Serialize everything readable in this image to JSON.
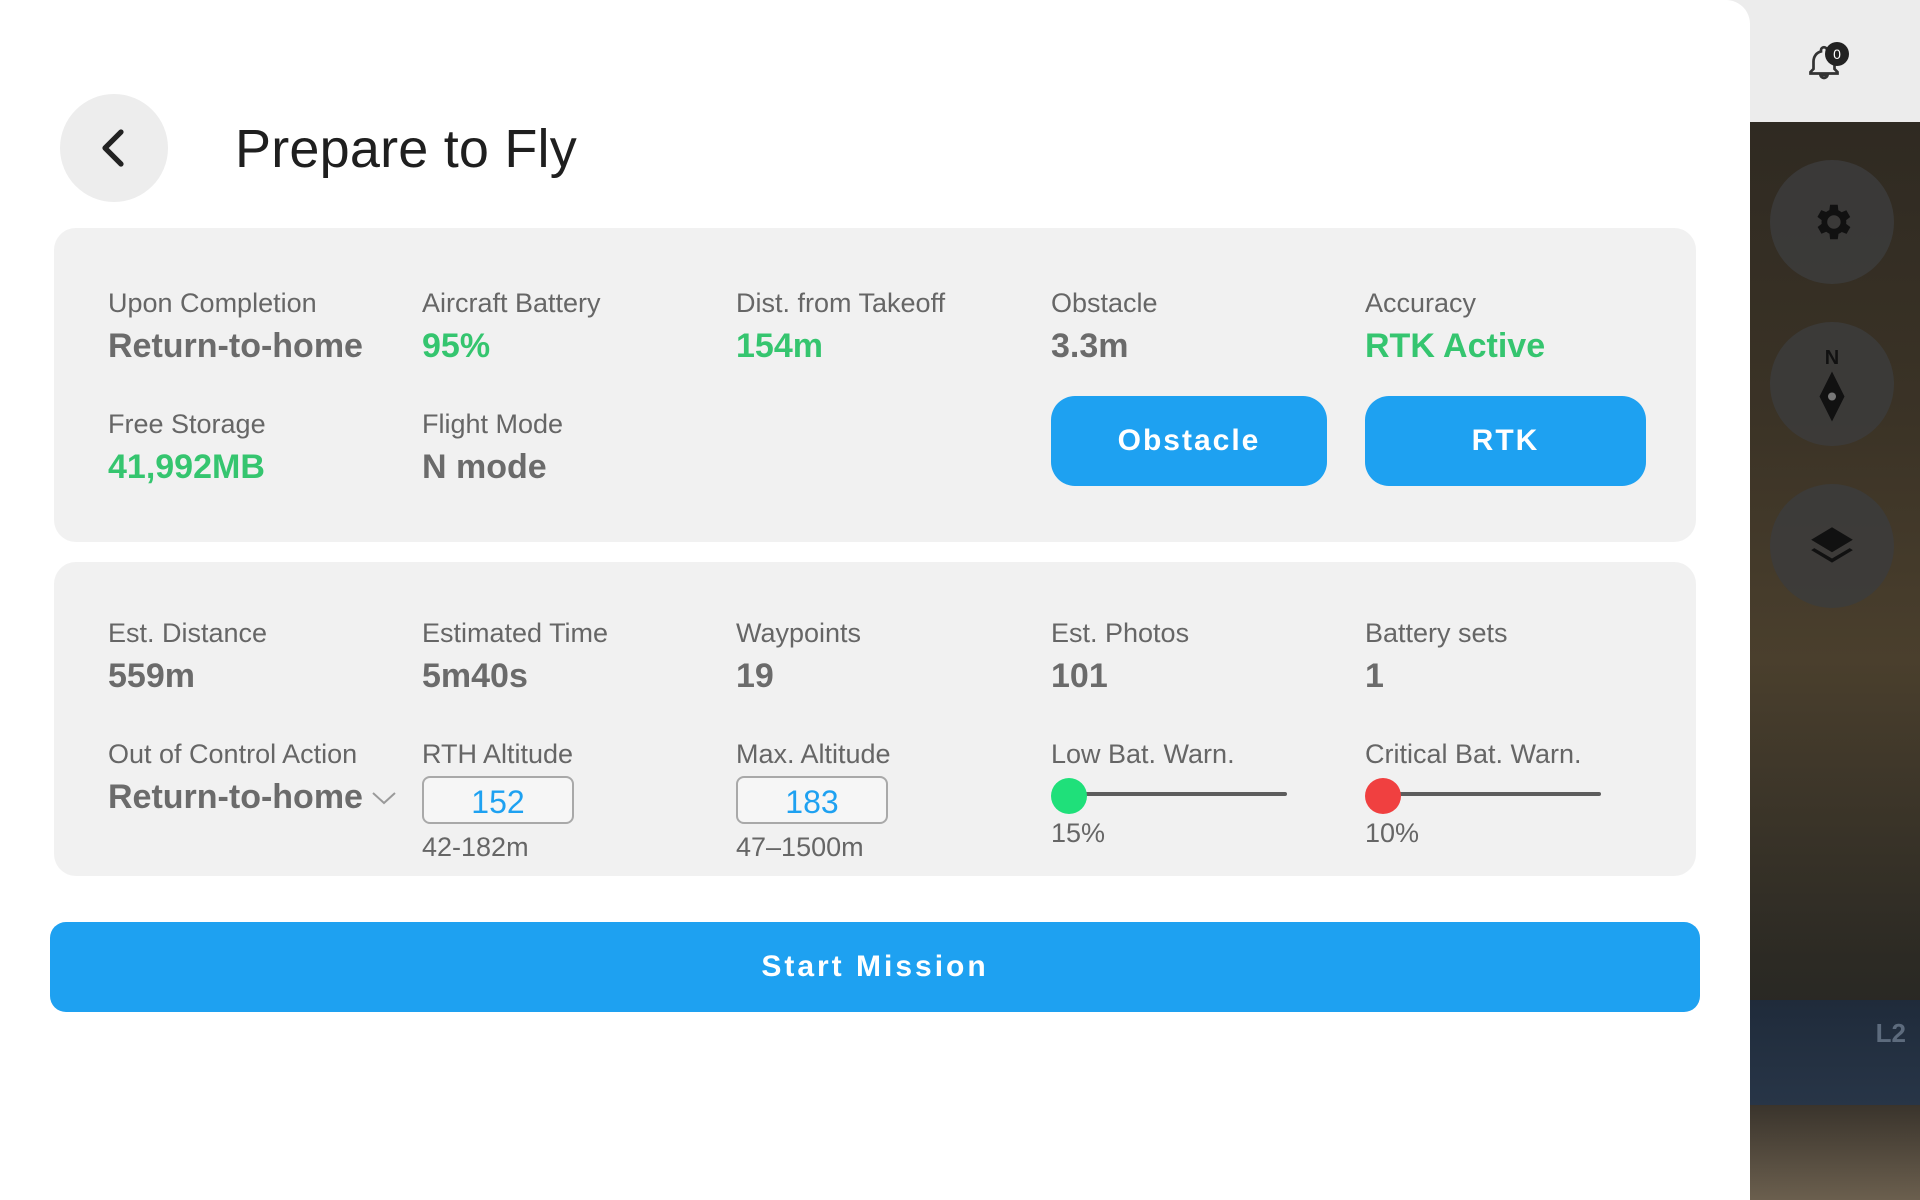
{
  "header": {
    "title": "Prepare to Fly"
  },
  "notifications": {
    "count": "0"
  },
  "map": {
    "layer_label": "L2"
  },
  "status_panel": {
    "upon_completion": {
      "label": "Upon Completion",
      "value": "Return-to-home"
    },
    "aircraft_battery": {
      "label": "Aircraft Battery",
      "value": "95%"
    },
    "dist_from_takeoff": {
      "label": "Dist. from Takeoff",
      "value": "154m"
    },
    "obstacle": {
      "label": "Obstacle",
      "value": "3.3m"
    },
    "accuracy": {
      "label": "Accuracy",
      "value": "RTK Active"
    },
    "free_storage": {
      "label": "Free Storage",
      "value": "41,992MB"
    },
    "flight_mode": {
      "label": "Flight Mode",
      "value": "N mode"
    },
    "obstacle_button": "Obstacle",
    "rtk_button": "RTK"
  },
  "mission_panel": {
    "est_distance": {
      "label": "Est. Distance",
      "value": "559m"
    },
    "estimated_time": {
      "label": "Estimated Time",
      "value": "5m40s"
    },
    "waypoints": {
      "label": "Waypoints",
      "value": "19"
    },
    "est_photos": {
      "label": "Est. Photos",
      "value": "101"
    },
    "battery_sets": {
      "label": "Battery sets",
      "value": "1"
    },
    "out_of_control": {
      "label": "Out of Control Action",
      "value": "Return-to-home"
    },
    "rth_altitude": {
      "label": "RTH Altitude",
      "value": "152",
      "range": "42-182m"
    },
    "max_altitude": {
      "label": "Max. Altitude",
      "value": "183",
      "range": "47–1500m"
    },
    "low_bat": {
      "label": "Low Bat. Warn.",
      "value": "15%",
      "level": 0.0
    },
    "critical_bat": {
      "label": "Critical Bat. Warn.",
      "value": "10%",
      "level": 0.0
    }
  },
  "start_button": "Start Mission",
  "colors": {
    "accent": "#1ea1f1",
    "good": "#35c56f",
    "low_knob": "#1fe07a",
    "critical_knob": "#f04040"
  }
}
